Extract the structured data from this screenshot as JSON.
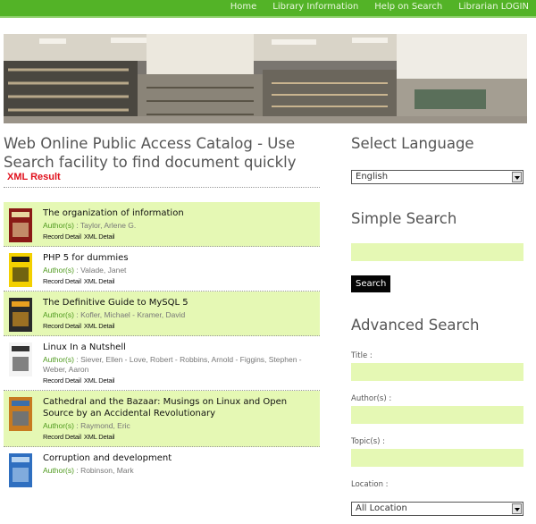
{
  "nav": [
    "Home",
    "Library Information",
    "Help on Search",
    "Librarian LOGIN"
  ],
  "page_title": "Web Online Public Access Catalog - Use Search facility to find document quickly",
  "xml_link": "XML Result",
  "author_label": "Author(s)",
  "link_labels": [
    "Record Detail",
    "XML Detail"
  ],
  "results": [
    {
      "title": "The organization of information",
      "authors": "Taylor, Arlene G.",
      "highlight": true,
      "cover_icon": "book-cover-organization"
    },
    {
      "title": "PHP 5 for dummies",
      "authors": "Valade, Janet",
      "highlight": false,
      "cover_icon": "book-cover-php5"
    },
    {
      "title": "The Definitive Guide to MySQL 5",
      "authors": "Kofler, Michael - Kramer, David",
      "highlight": true,
      "cover_icon": "book-cover-mysql"
    },
    {
      "title": "Linux In a Nutshell",
      "authors": "Siever, Ellen - Love, Robert - Robbins, Arnold - Figgins, Stephen - Weber, Aaron",
      "highlight": false,
      "cover_icon": "book-cover-linux"
    },
    {
      "title": "Cathedral and the Bazaar: Musings on Linux and Open Source by an Accidental Revolutionary",
      "authors": "Raymond, Eric",
      "highlight": true,
      "cover_icon": "book-cover-cathedral"
    },
    {
      "title": "Corruption and development",
      "authors": "Robinson, Mark",
      "highlight": false,
      "cover_icon": "book-cover-corruption"
    }
  ],
  "sidebar": {
    "language_heading": "Select Language",
    "language_value": "English",
    "simple_heading": "Simple Search",
    "search_button": "Search",
    "advanced_heading": "Advanced Search",
    "title_label": "Title :",
    "author_label": "Author(s) :",
    "topic_label": "Topic(s) :",
    "location_label": "Location :",
    "location_value": "All Location"
  },
  "colors": {
    "accent_green": "#53b327",
    "highlight": "#e5f8b4",
    "xml_red": "#e0101c"
  }
}
